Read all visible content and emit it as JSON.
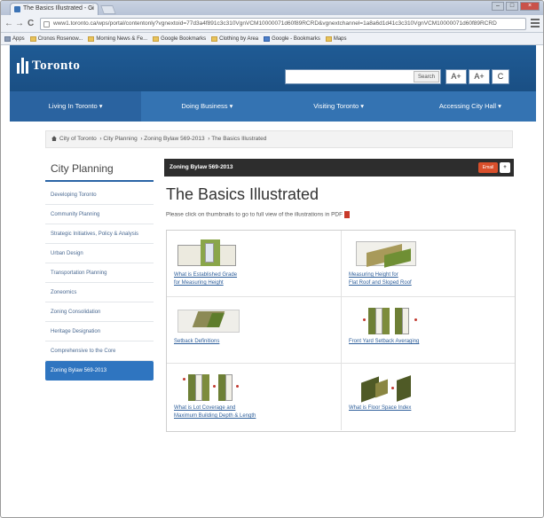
{
  "browser": {
    "tab_title": "The Basics Illustrated - Ci",
    "tab_close": "×",
    "url": "www1.toronto.ca/wps/portal/contentonly?vgnextoid=77d3a4f891c3c310VgnVCM10000071d60f89RCRD&vgnextchannel=1a8a6d1d41c3c310VgnVCM10000071d60f89RCRD",
    "window_controls": [
      "–",
      "□",
      "×"
    ],
    "nav": {
      "back": "←",
      "forward": "→",
      "reload": "C"
    },
    "bookmarks": [
      {
        "label": "Apps",
        "icon": "apps-icon"
      },
      {
        "label": "Cronos Rosenow...",
        "icon": "folder-icon"
      },
      {
        "label": "Morning News & Fe...",
        "icon": "folder-icon"
      },
      {
        "label": "Google Bookmarks",
        "icon": "folder-icon"
      },
      {
        "label": "Clothing by Area",
        "icon": "folder-icon"
      },
      {
        "label": "Google - Bookmarks",
        "icon": "blue-icon"
      },
      {
        "label": "Maps",
        "icon": "folder-icon"
      }
    ]
  },
  "site": {
    "logo_text": "Toronto",
    "search_button": "Search",
    "font_controls": [
      "A+",
      "A+",
      "C"
    ],
    "nav_items": [
      {
        "label": "Living In Toronto ▾",
        "active": true
      },
      {
        "label": "Doing Business ▾",
        "active": false
      },
      {
        "label": "Visiting Toronto ▾",
        "active": false
      },
      {
        "label": "Accessing City Hall ▾",
        "active": false
      }
    ]
  },
  "breadcrumb": [
    "City of Toronto",
    "City Planning",
    "Zoning Bylaw 569-2013",
    "The Basics Illustrated"
  ],
  "sidebar": {
    "title": "City Planning",
    "items": [
      {
        "label": "Developing Toronto",
        "active": false
      },
      {
        "label": "Community Planning",
        "active": false
      },
      {
        "label": "Strategic Initiatives, Policy & Analysis",
        "active": false
      },
      {
        "label": "Urban Design",
        "active": false
      },
      {
        "label": "Transportation Planning",
        "active": false
      },
      {
        "label": "Zoneomics",
        "active": false
      },
      {
        "label": "Zoning Consolidation",
        "active": false
      },
      {
        "label": "Heritage Designation",
        "active": false
      },
      {
        "label": "Comprehensive to the Core",
        "active": false
      },
      {
        "label": "Zoning Bylaw 569-2013",
        "active": true
      }
    ]
  },
  "content": {
    "bar_title": "Zoning Bylaw 569-2013",
    "bar_button": "Email",
    "bar_icon": "+",
    "page_title": "The Basics Illustrated",
    "note": "Please click on thumbnails to go to full view of the illustrations in PDF",
    "pdf_icon": "pdf-icon",
    "items": [
      {
        "caption_1": "What is Established Grade",
        "caption_2": "for Measuring Height"
      },
      {
        "caption_1": "Measuring Height for",
        "caption_2": "Flat Roof and Sloped Roof"
      },
      {
        "caption_1": "Setback Definitions",
        "caption_2": ""
      },
      {
        "caption_1": "Front Yard Setback Averaging",
        "caption_2": ""
      },
      {
        "caption_1": "What is Lot Coverage and",
        "caption_2": "Maximum Building Depth & Length"
      },
      {
        "caption_1": "What is Floor Space Index",
        "caption_2": ""
      }
    ]
  },
  "colors": {
    "header_blue": "#1f5b95",
    "nav_blue": "#3473b2",
    "sidebar_active": "#2f75c0",
    "zoning_bar": "#2d2d2d",
    "email_button": "#d94f2b"
  }
}
